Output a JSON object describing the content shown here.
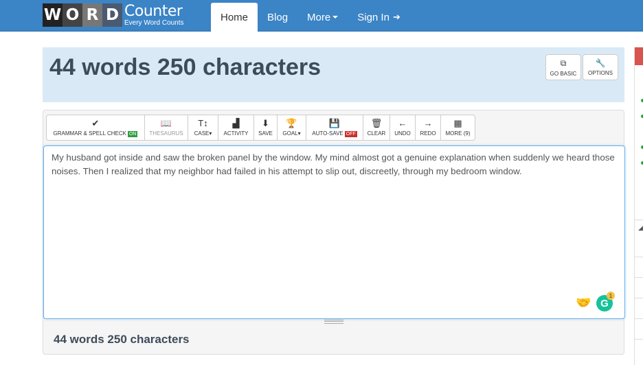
{
  "nav": {
    "logo_letters": [
      "W",
      "O",
      "R",
      "D"
    ],
    "logo_title": "Counter",
    "logo_tagline": "Every Word Counts",
    "items": [
      {
        "label": "Home"
      },
      {
        "label": "Blog"
      },
      {
        "label": "More"
      },
      {
        "label": "Sign In"
      }
    ]
  },
  "header": {
    "title": "44 words 250 characters",
    "go_basic": "GO BASIC",
    "options": "OPTIONS"
  },
  "toolbar": {
    "grammar": "GRAMMAR & SPELL CHECK",
    "grammar_badge": "ON",
    "thesaurus": "THESAURUS",
    "case": "CASE",
    "activity": "ACTIVITY",
    "save": "SAVE",
    "goal": "GOAL",
    "autosave": "AUTO-SAVE",
    "autosave_badge": "OFF",
    "clear": "CLEAR",
    "undo": "UNDO",
    "redo": "REDO",
    "more": "MORE (9)"
  },
  "editor": {
    "text": "My husband got inside and saw the broken panel by the window. My mind almost got a genuine explanation when suddenly we heard those noises. Then I realized that my neighbor had failed in his attempt to slip out, discreetly, through my bedroom window.",
    "grammarly_count": "1"
  },
  "footer": {
    "count": "44 words 250 characters"
  },
  "icons": {
    "grammar": "check-icon",
    "thesaurus": "book-icon",
    "case": "text-case-icon",
    "activity": "bar-chart-icon",
    "save": "save-icon",
    "goal": "trophy-icon",
    "autosave": "floppy-icon",
    "clear": "trash-icon",
    "undo": "arrow-left-icon",
    "redo": "arrow-right-icon",
    "more": "grid-icon"
  },
  "colors": {
    "navbar": "#3b84c6",
    "header_bg": "#d9eaf6",
    "badge_on": "#2e9e3f",
    "badge_off": "#c9302c",
    "grammarly": "#15c39a"
  }
}
